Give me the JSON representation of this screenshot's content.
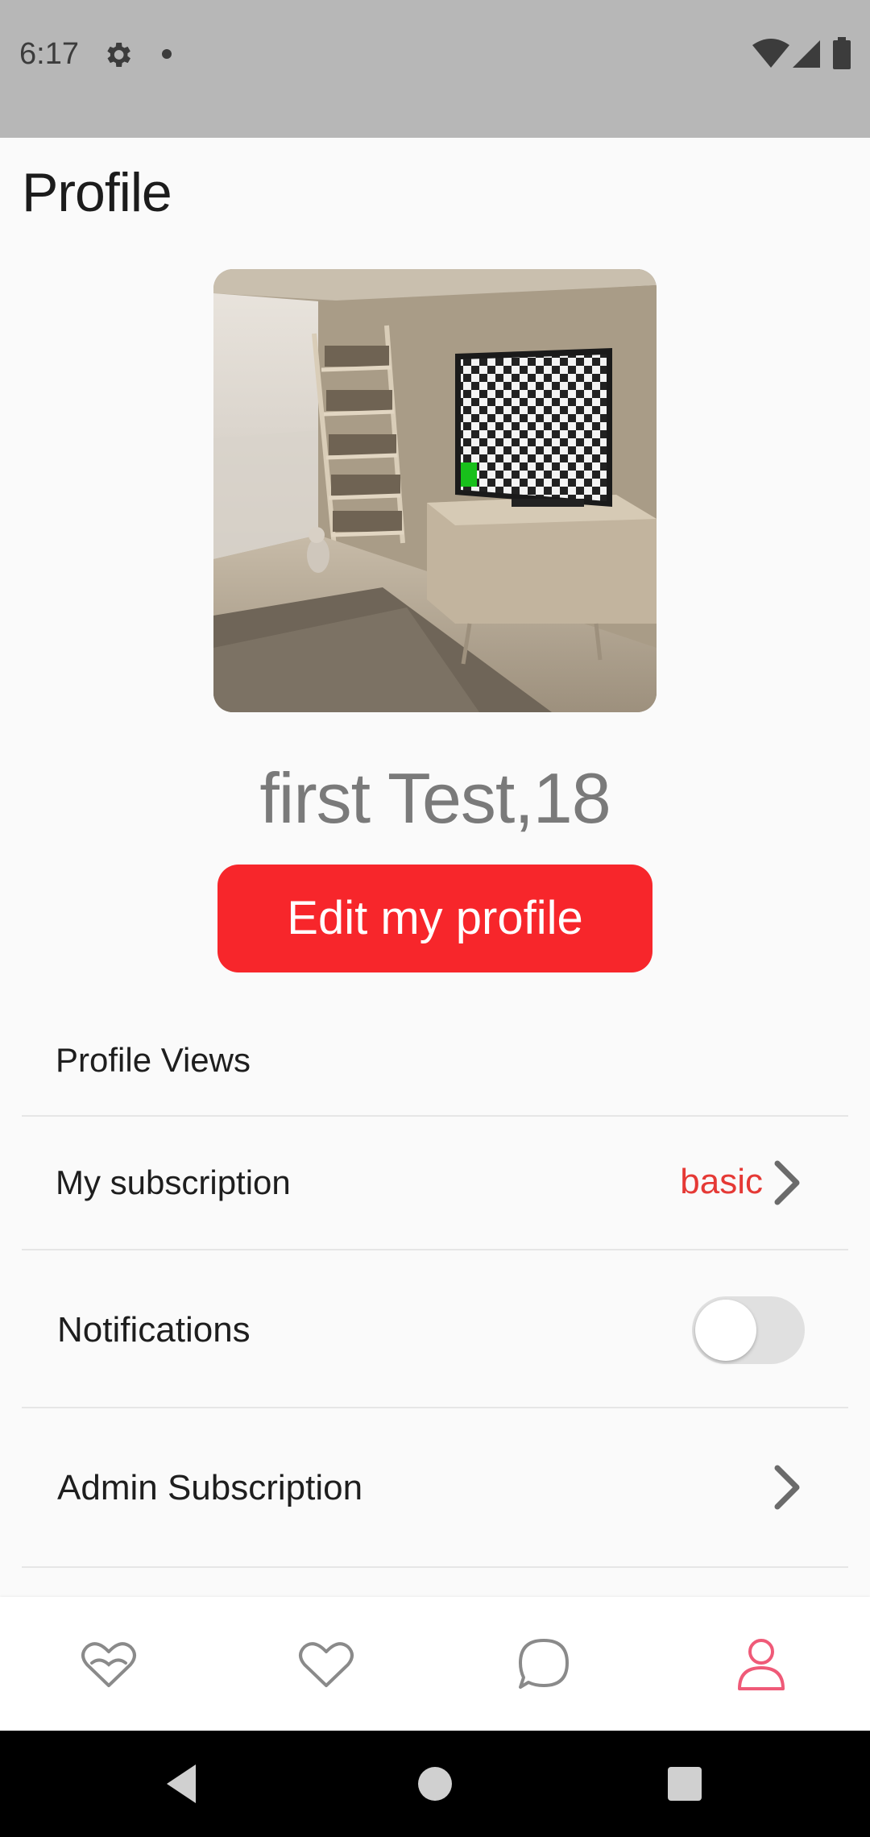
{
  "status_bar": {
    "time": "6:17"
  },
  "page": {
    "title": "Profile"
  },
  "profile": {
    "name_age": "first Test,18",
    "edit_label": "Edit my profile"
  },
  "settings": {
    "profile_views_label": "Profile Views",
    "subscription_label": "My subscription",
    "subscription_value": "basic",
    "notifications_label": "Notifications",
    "notifications_enabled": false,
    "admin_subscription_label": "Admin Subscription"
  },
  "bottom_nav": {
    "items": [
      {
        "icon": "double-heart-icon",
        "active": false
      },
      {
        "icon": "heart-icon",
        "active": false
      },
      {
        "icon": "chat-bubble-icon",
        "active": false
      },
      {
        "icon": "person-icon",
        "active": true
      }
    ]
  },
  "colors": {
    "accent": "#f7262b",
    "subscription_value": "#e53935",
    "active_nav": "#ef5a78",
    "inactive_nav": "#8a8a8a"
  }
}
